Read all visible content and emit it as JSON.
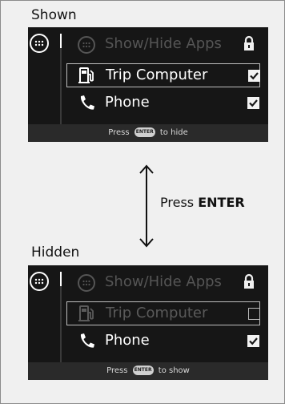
{
  "sections": {
    "shown": {
      "label": "Shown",
      "header_title": "Show/Hide Apps",
      "rows": [
        {
          "label": "Trip Computer",
          "checked": true,
          "selected": true
        },
        {
          "label": "Phone",
          "checked": true,
          "selected": false
        }
      ],
      "footer": {
        "prefix": "Press",
        "key": "ENTER",
        "suffix": "to hide"
      }
    },
    "hidden": {
      "label": "Hidden",
      "header_title": "Show/Hide Apps",
      "rows": [
        {
          "label": "Trip Computer",
          "checked": false,
          "selected": true
        },
        {
          "label": "Phone",
          "checked": true,
          "selected": false
        }
      ],
      "footer": {
        "prefix": "Press",
        "key": "ENTER",
        "suffix": "to show"
      }
    }
  },
  "transition": {
    "prefix": "Press",
    "key": "ENTER"
  },
  "icons": [
    "home-grid-icon",
    "apps-grid-icon",
    "lock-icon",
    "fuel-pump-icon",
    "phone-icon",
    "check-icon",
    "double-arrow-icon"
  ],
  "colors": {
    "screen_bg": "#161616",
    "footer_bg": "#2a2a2a",
    "text": "#ffffff",
    "dim_text": "#5a5a5a"
  }
}
